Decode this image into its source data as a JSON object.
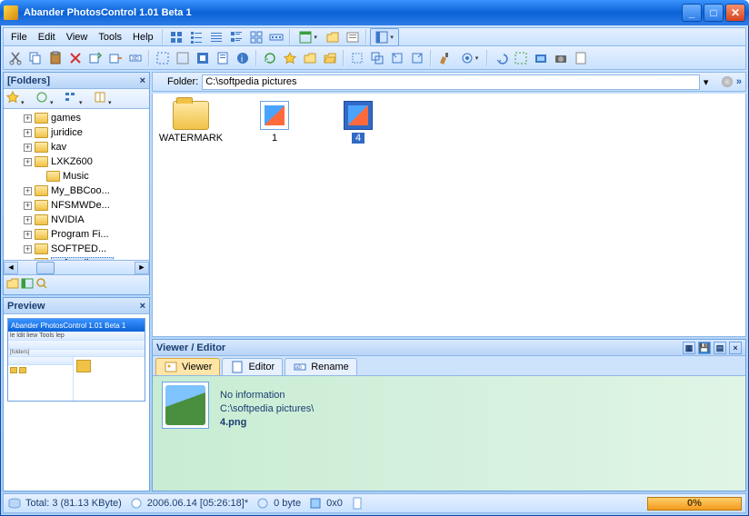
{
  "title": "Abander PhotosControl 1.01 Beta 1",
  "menu": {
    "file": "File",
    "edit": "Edit",
    "view": "View",
    "tools": "Tools",
    "help": "Help"
  },
  "folders": {
    "header": "[Folders]",
    "items": [
      {
        "label": "games",
        "expandable": true
      },
      {
        "label": "juridice",
        "expandable": true
      },
      {
        "label": "kav",
        "expandable": true
      },
      {
        "label": "LXKZ600",
        "expandable": true
      },
      {
        "label": "Music",
        "expandable": false,
        "indent": true
      },
      {
        "label": "My_BBCoo...",
        "expandable": true
      },
      {
        "label": "NFSMWDe...",
        "expandable": true
      },
      {
        "label": "NVIDIA",
        "expandable": true
      },
      {
        "label": "Program Fi...",
        "expandable": true
      },
      {
        "label": "SOFTPED...",
        "expandable": true
      },
      {
        "label": "softpedia p...",
        "expandable": false,
        "expanded": true,
        "selected": true
      }
    ]
  },
  "preview": {
    "header": "Preview",
    "mini_title": "Abander PhotosControl 1.01 Beta 1"
  },
  "folderbar": {
    "label": "Folder:",
    "path": "C:\\softpedia pictures"
  },
  "files": [
    {
      "name": "WATERMARK",
      "type": "folder"
    },
    {
      "name": "1",
      "type": "image"
    },
    {
      "name": "4",
      "type": "image",
      "selected": true
    }
  ],
  "viewer": {
    "header": "Viewer / Editor",
    "tabs": {
      "viewer": "Viewer",
      "editor": "Editor",
      "rename": "Rename"
    },
    "info_line1": "No information",
    "info_line2": "C:\\softpedia pictures\\",
    "info_filename": "4.png"
  },
  "status": {
    "total": "Total: 3 (81.13 KByte)",
    "date": "2006.06.14 [05:26:18]*",
    "size": "0 byte",
    "dims": "0x0",
    "progress": "0%"
  }
}
